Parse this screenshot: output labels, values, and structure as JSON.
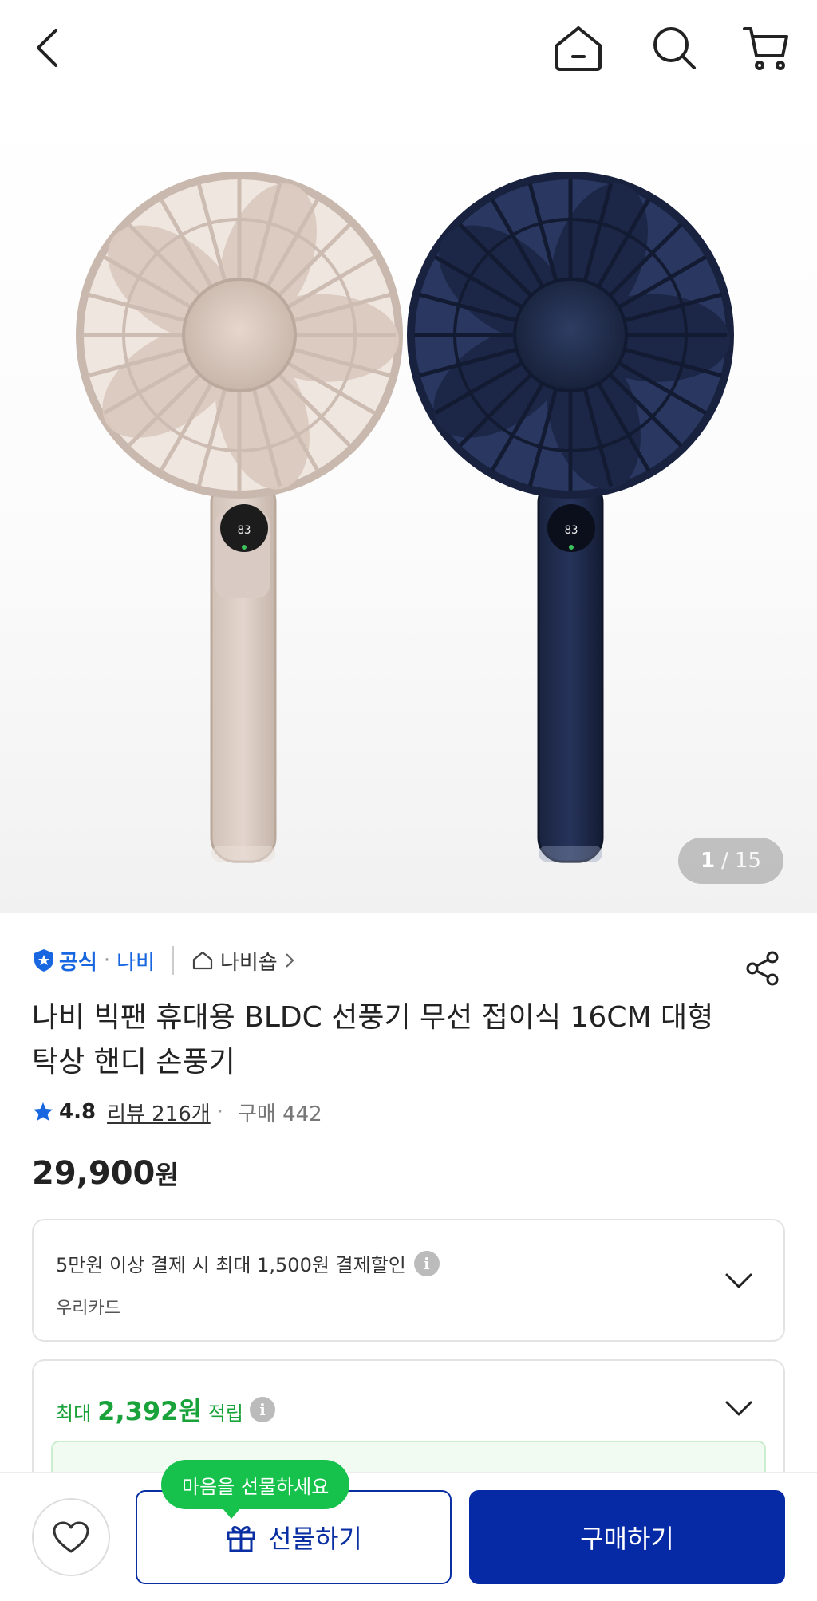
{
  "topbar": {
    "back_icon": "chevron-left-icon",
    "home_icon": "home-icon",
    "search_icon": "search-icon",
    "cart_icon": "cart-icon"
  },
  "gallery": {
    "current": "1",
    "separator": "/",
    "total": "15",
    "fan_colors": [
      "#d9cbc3",
      "#1f2c4d"
    ]
  },
  "product": {
    "official_label": "공식",
    "brand": "나비",
    "shop_name": "나비숍",
    "title": "나비 빅팬 휴대용 BLDC 선풍기 무선 접이식 16CM 대형 탁상 핸디 손풍기",
    "rating": "4.8",
    "reviews": "리뷰 216개",
    "purchases": "구매 442",
    "price": "29,900",
    "price_unit": "원"
  },
  "discount_card": {
    "text": "5만원 이상 결제 시 최대 1,500원 결제할인",
    "card_name": "우리카드"
  },
  "reward_card": {
    "prefix": "최대",
    "amount": "2,392원",
    "suffix": "적립"
  },
  "bottom": {
    "tooltip": "마음을 선물하세요",
    "gift_label": "선물하기",
    "buy_label": "구매하기"
  },
  "colors": {
    "accent_blue": "#0629a6",
    "official_blue": "#1866e0",
    "reward_green": "#19a13a",
    "tooltip_green": "#16c24b"
  }
}
